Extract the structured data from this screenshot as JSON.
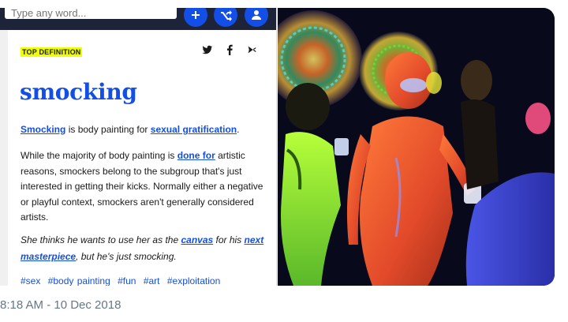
{
  "ud": {
    "search_placeholder": "Type any word...",
    "label": "TOP DEFINITION",
    "word": "smocking",
    "meaning": {
      "link1": "Smocking",
      "text1": " is body painting for ",
      "link2": "sexual gratification",
      "text2": "."
    },
    "explain": {
      "text1": "While the majority of body painting is ",
      "link1": "done for",
      "text2": " artistic reasons, smockers belong to the subgroup that's just interested in getting their kicks. Normally either a negative or playful context, smockers aren't generally considered artists."
    },
    "example": {
      "text1": "She thinks he wants to use her as the ",
      "link1": "canvas",
      "text2": " for his ",
      "link2": "next",
      "text3": " ",
      "link3": "masterpiece",
      "text4": ", but he's just smocking."
    },
    "tags": [
      "#sex",
      "#body painting",
      "#fun",
      "#art",
      "#exploitation"
    ]
  },
  "tweet": {
    "timestamp": "8:18 AM - 10 Dec 2018"
  },
  "colors": {
    "ud_blue": "#134fe6",
    "highlight": "#efff00",
    "timestamp": "#657786"
  }
}
